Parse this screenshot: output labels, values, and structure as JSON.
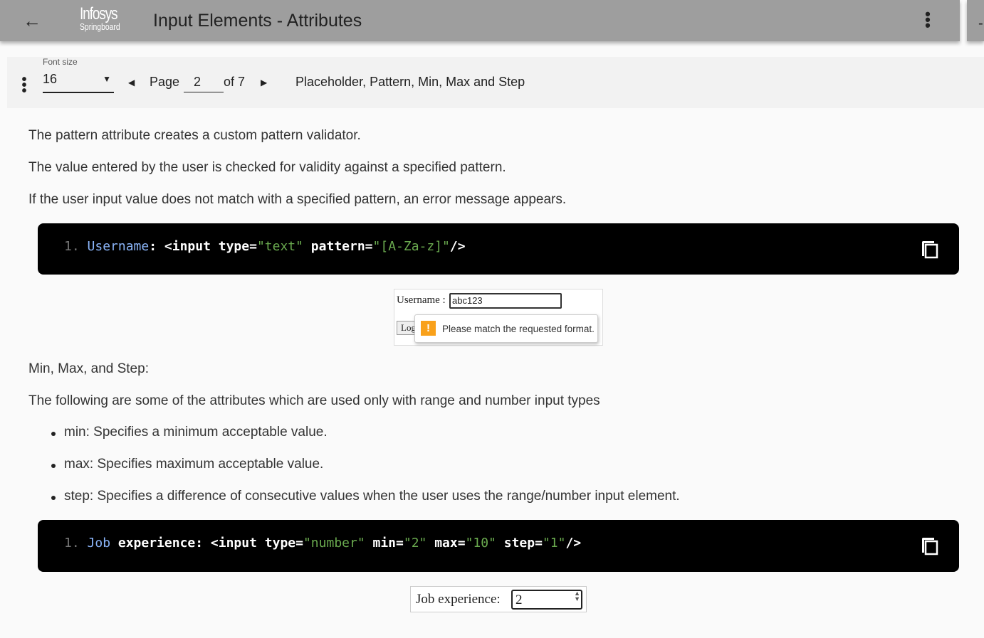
{
  "header": {
    "title": "Input Elements - Attributes",
    "logo_line1": "Infosys",
    "logo_line2": "Springboard"
  },
  "toolbar": {
    "font_size_label": "Font size",
    "font_size_value": "16",
    "page_label": "Page",
    "page_value": "2",
    "page_total": "of 7",
    "section_title": "Placeholder, Pattern, Min, Max and Step"
  },
  "pattern": {
    "p1": "The pattern attribute creates a custom pattern validator.",
    "p2": "The value entered by the user is checked for validity against a specified pattern.",
    "p3": "If the user input value does not match with a specified pattern, an error message appears.",
    "code": [
      {
        "t": "1. ",
        "c": "num"
      },
      {
        "t": "Username",
        "c": "blue"
      },
      {
        "t": ": <input type=",
        "c": "w"
      },
      {
        "t": "\"text\"",
        "c": "str"
      },
      {
        "t": " pattern=",
        "c": "w"
      },
      {
        "t": "\"[A-Za-z]\"",
        "c": "str"
      },
      {
        "t": "/>",
        "c": "w"
      }
    ],
    "demo": {
      "label": "Username :",
      "value": "abc123",
      "button": "Login",
      "tooltip": "Please match the requested format."
    }
  },
  "minmax": {
    "heading": "Min, Max, and Step:",
    "intro": "The following are some of the attributes which are used only with range and number input types",
    "bullets": [
      "min: Specifies a minimum acceptable value.",
      "max: Specifies maximum acceptable value.",
      "step: Specifies a difference of consecutive values when the user uses the range/number input element."
    ],
    "code": [
      {
        "t": "1. ",
        "c": "num"
      },
      {
        "t": "Job",
        "c": "blue"
      },
      {
        "t": " experience: <input type=",
        "c": "w"
      },
      {
        "t": "\"number\"",
        "c": "str"
      },
      {
        "t": " min=",
        "c": "w"
      },
      {
        "t": "\"2\"",
        "c": "str"
      },
      {
        "t": " max=",
        "c": "w"
      },
      {
        "t": "\"10\"",
        "c": "str"
      },
      {
        "t": " step=",
        "c": "w"
      },
      {
        "t": "\"1\"",
        "c": "str"
      },
      {
        "t": "/>",
        "c": "w"
      }
    ],
    "demo": {
      "label": "Job experience:",
      "value": "2"
    }
  }
}
